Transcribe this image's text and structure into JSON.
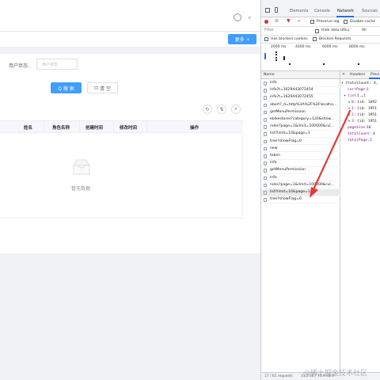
{
  "app": {
    "more_button": "更多",
    "status_label": "用户状态:",
    "status_placeholder": "用户状态",
    "search_button": "Q 搜 索",
    "reset_button": "清 空",
    "columns": [
      "姓名",
      "角色名称",
      "创建时间",
      "修改时间",
      "操作"
    ],
    "empty_text": "暂无数据"
  },
  "devtools": {
    "tabs": [
      "Elements",
      "Console",
      "Network",
      "Sources"
    ],
    "active_tab": "Network",
    "filter_placeholder": "Filter",
    "hide_data_urls": "Hide data URLs",
    "all": "All",
    "preserve_log": "Preserve log",
    "disable_cache": "Disable cache",
    "has_blocked_cookies": "Has blocked cookies",
    "blocked_requests": "Blocked Requests",
    "timeline_ticks": [
      "2000 ms",
      "4000 ms",
      "6000 ms",
      "8000 ms"
    ],
    "name_header": "Name",
    "detail_tabs": [
      "Headers",
      "Previ"
    ],
    "requests": [
      "info",
      "info?t=1629443072454",
      "info?t=1629443072455",
      "abort?_d=http%3A%2F%2Flocalho...",
      "getMenuPermission",
      "ebikestores?category=120&show...",
      "roles?page=1&limit=100000&rul...",
      "list?limit=10&page=1",
      "tree?showFlag=0",
      "new",
      "token",
      "info",
      "getMenuPermission",
      "info",
      "roles?page=1&limit=100000&rul...",
      "list?limit=10&page=1",
      "tree?showFlag=0"
    ],
    "selected_index": 15,
    "preview": {
      "line1": "{totalCount: 4,",
      "currPage_key": "currPage:",
      "currPage_val": "1",
      "list_key": "list:",
      "list_val": "[,…]",
      "items": [
        {
          "idx": "0:",
          "val": "{id: 1692"
        },
        {
          "idx": "1:",
          "val": "{id: 1951"
        },
        {
          "idx": "2:",
          "val": "{id: 1951"
        },
        {
          "idx": "3:",
          "val": "{id: 1951"
        }
      ],
      "pageSize_key": "pageSize:",
      "pageSize_val": "10",
      "totalCount_key": "totalCount:",
      "totalCount_val": "4",
      "totalPage_key": "totalPage:",
      "totalPage_val": "1"
    },
    "status_bar": "17 / 61 requests",
    "status_bar2": "31.7 kB / 75.9 kB tr",
    "watermark": "@稀土掘金技术社区"
  },
  "colors": {
    "accent": "#409eff",
    "arrow": "#e53935",
    "selected_row": "#e8eaed"
  }
}
